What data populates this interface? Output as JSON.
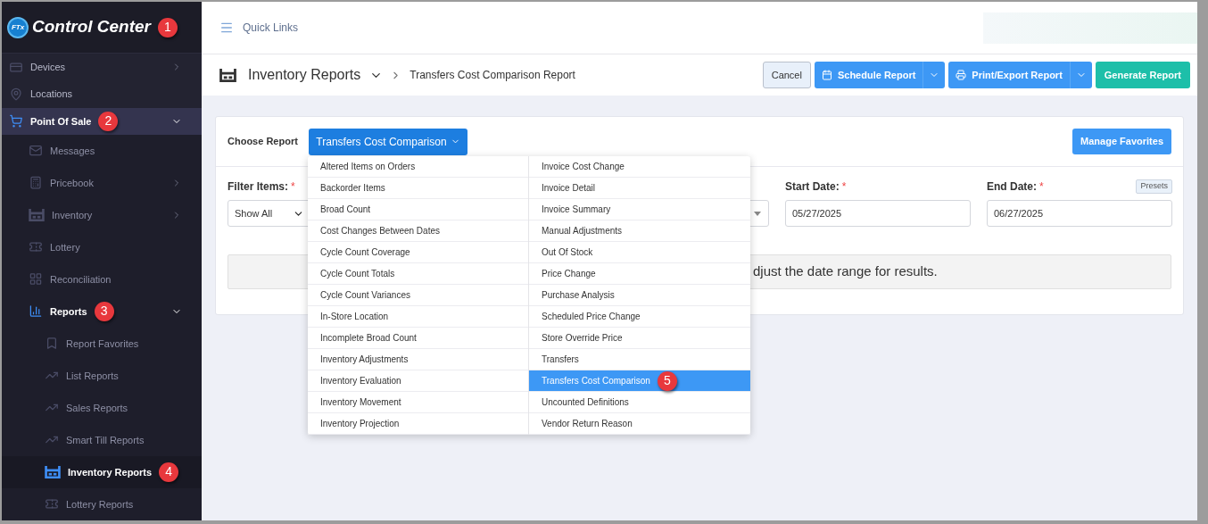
{
  "sidebar": {
    "logo": {
      "badge": "FTx",
      "text": "Control Center",
      "callout": "1"
    },
    "items": [
      {
        "label": "Devices",
        "expanded": false,
        "selected": false
      },
      {
        "label": "Locations",
        "selected": false
      },
      {
        "label": "Point Of Sale",
        "expanded": true,
        "selected": true,
        "callout": "2",
        "children": [
          {
            "label": "Messages",
            "selected": false
          },
          {
            "label": "Pricebook",
            "expanded": false,
            "selected": false
          },
          {
            "label": "Inventory",
            "expanded": false,
            "selected": false
          },
          {
            "label": "Lottery",
            "selected": false
          },
          {
            "label": "Reconciliation",
            "selected": false
          },
          {
            "label": "Reports",
            "expanded": true,
            "selected": true,
            "callout": "3",
            "children": [
              {
                "label": "Report Favorites",
                "selected": false
              },
              {
                "label": "List Reports",
                "selected": false
              },
              {
                "label": "Sales Reports",
                "selected": false
              },
              {
                "label": "Smart Till Reports",
                "selected": false
              },
              {
                "label": "Inventory Reports",
                "selected": true,
                "callout": "4"
              },
              {
                "label": "Lottery Reports",
                "selected": false
              }
            ]
          }
        ]
      }
    ]
  },
  "top_bar": {
    "link": "Quick Links"
  },
  "header": {
    "section": "Inventory Reports",
    "page": "Transfers Cost Comparison Report",
    "buttons": [
      {
        "label": "Cancel",
        "kind": "plain"
      },
      {
        "label": "Schedule Report",
        "kind": "split"
      },
      {
        "label": "Print/Export Report",
        "kind": "split"
      },
      {
        "label": "Generate Report",
        "kind": "primary"
      }
    ]
  },
  "card": {
    "choose_label": "Choose Report",
    "choose_value": "Transfers Cost Comparison",
    "manage_button": "Manage Favorites",
    "filter_label": "Filter Items:",
    "filter_required": "*",
    "filter_value": "Show All",
    "start_label": "Start Date:",
    "start_required": "*",
    "start_value": "05/27/2025",
    "end_label": "End Date:",
    "end_required": "*",
    "end_value": "06/27/2025",
    "presets_button": "Presets",
    "message": "djust the date range for results."
  },
  "report_menu": {
    "columns": [
      [
        {
          "label": "Altered Items on Orders",
          "selected": false
        },
        {
          "label": "Backorder Items",
          "selected": false
        },
        {
          "label": "Broad Count",
          "selected": false
        },
        {
          "label": "Cost Changes Between Dates",
          "selected": false
        },
        {
          "label": "Cycle Count Coverage",
          "selected": false
        },
        {
          "label": "Cycle Count Totals",
          "selected": false
        },
        {
          "label": "Cycle Count Variances",
          "selected": false
        },
        {
          "label": "In-Store Location",
          "selected": false
        },
        {
          "label": "Incomplete Broad Count",
          "selected": false
        },
        {
          "label": "Inventory Adjustments",
          "selected": false
        },
        {
          "label": "Inventory Evaluation",
          "selected": false
        },
        {
          "label": "Inventory Movement",
          "selected": false
        },
        {
          "label": "Inventory Projection",
          "selected": false
        }
      ],
      [
        {
          "label": "Invoice Cost Change",
          "selected": false
        },
        {
          "label": "Invoice Detail",
          "selected": false
        },
        {
          "label": "Invoice Summary",
          "selected": false
        },
        {
          "label": "Manual Adjustments",
          "selected": false
        },
        {
          "label": "Out Of Stock",
          "selected": false
        },
        {
          "label": "Price Change",
          "selected": false
        },
        {
          "label": "Purchase Analysis",
          "selected": false
        },
        {
          "label": "Scheduled Price Change",
          "selected": false
        },
        {
          "label": "Store Override Price",
          "selected": false
        },
        {
          "label": "Transfers",
          "selected": false
        },
        {
          "label": "Transfers Cost Comparison",
          "selected": true,
          "callout": "5"
        },
        {
          "label": "Uncounted Definitions",
          "selected": false
        },
        {
          "label": "Vendor Return Reason",
          "selected": false
        }
      ]
    ]
  }
}
